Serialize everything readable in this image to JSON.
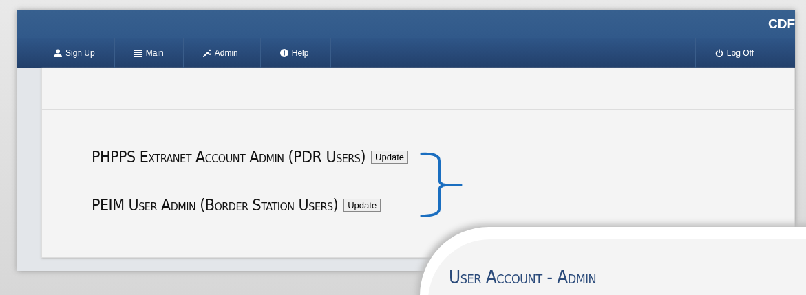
{
  "header": {
    "brand": "CDF"
  },
  "nav": {
    "items": [
      {
        "label": "Sign Up",
        "kind": "user"
      },
      {
        "label": "Main",
        "kind": "list"
      },
      {
        "label": "Admin",
        "kind": "wrench"
      },
      {
        "label": "Help",
        "kind": "info"
      }
    ],
    "right": {
      "label": "Log Off",
      "kind": "power"
    }
  },
  "admin_links": [
    {
      "label": "PHPPS Extranet Account Admin (PDR Users)",
      "button": "Update"
    },
    {
      "label": "PEIM User Admin (Border Station Users)",
      "button": "Update"
    }
  ],
  "callout": {
    "title": "User Account - Admin"
  }
}
